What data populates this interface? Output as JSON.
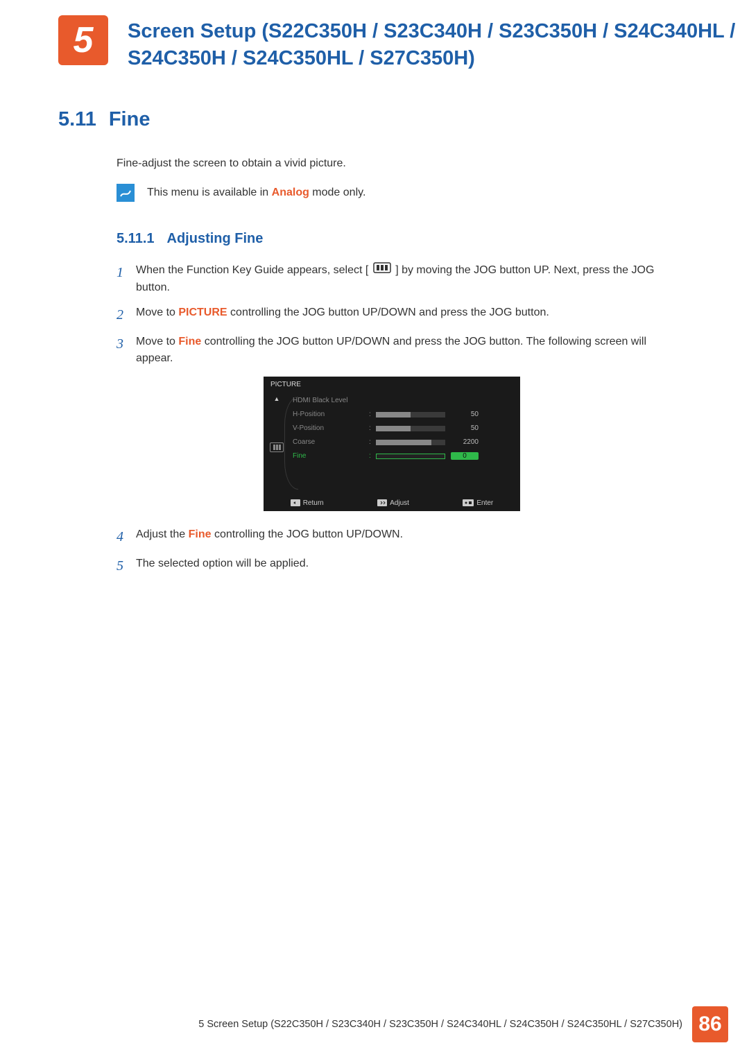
{
  "chapter": {
    "number": "5",
    "title": "Screen Setup (S22C350H / S23C340H / S23C350H / S24C340HL / S24C350H / S24C350HL / S27C350H)"
  },
  "section": {
    "number": "5.11",
    "title": "Fine",
    "intro": "Fine-adjust the screen to obtain a vivid picture.",
    "note_prefix": "This menu is available in ",
    "note_highlight": "Analog",
    "note_suffix": " mode only."
  },
  "subsection": {
    "number": "5.11.1",
    "title": "Adjusting Fine"
  },
  "steps": {
    "s1_a": "When the Function Key Guide appears, select ",
    "s1_b": " by moving the JOG button UP. Next, press the JOG button.",
    "s2_a": "Move to ",
    "s2_hl": "PICTURE",
    "s2_b": " controlling the JOG button UP/DOWN and press the JOG button.",
    "s3_a": "Move to ",
    "s3_hl": "Fine",
    "s3_b": " controlling the JOG button UP/DOWN and press the JOG button. The following screen will appear.",
    "s4_a": "Adjust the ",
    "s4_hl": "Fine",
    "s4_b": " controlling the JOG button UP/DOWN.",
    "s5": "The selected option will be applied."
  },
  "osd": {
    "title": "PICTURE",
    "rows": [
      {
        "label": "HDMI Black Level",
        "value": "",
        "fill": 0,
        "has_bar": false
      },
      {
        "label": "H-Position",
        "value": "50",
        "fill": 50,
        "has_bar": true
      },
      {
        "label": "V-Position",
        "value": "50",
        "fill": 50,
        "has_bar": true
      },
      {
        "label": "Coarse",
        "value": "2200",
        "fill": 80,
        "has_bar": true
      },
      {
        "label": "Fine",
        "value": "0",
        "fill": 0,
        "has_bar": true,
        "selected": true
      }
    ],
    "footer": {
      "return": "Return",
      "adjust": "Adjust",
      "enter": "Enter"
    }
  },
  "footer": {
    "text": "5 Screen Setup (S22C350H / S23C340H / S23C350H / S24C340HL / S24C350H / S24C350HL / S27C350H)",
    "page": "86"
  }
}
